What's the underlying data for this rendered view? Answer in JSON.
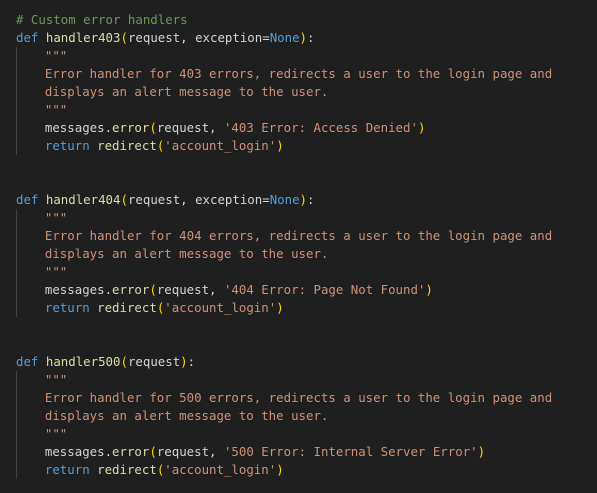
{
  "editor": {
    "comment": "# Custom error handlers",
    "blocks": [
      {
        "def_kw": "def",
        "func_name": "handler403",
        "params": "request, exception=None",
        "param_request": "request",
        "param_sep": ", ",
        "param_exception": "exception",
        "param_eq": "=",
        "param_default": "None",
        "close_colon": ":",
        "doc_open": "\"\"\"",
        "doc_line1": "Error handler for 403 errors, redirects a user to the login page and",
        "doc_line2": "displays an alert message to the user.",
        "doc_close": "\"\"\"",
        "messages_obj": "messages",
        "messages_method": "error",
        "messages_arg1": "request",
        "messages_arg2": "'403 Error: Access Denied'",
        "return_kw": "return",
        "redirect_fn": "redirect",
        "redirect_arg": "'account_login'"
      },
      {
        "def_kw": "def",
        "func_name": "handler404",
        "param_request": "request",
        "param_sep": ", ",
        "param_exception": "exception",
        "param_eq": "=",
        "param_default": "None",
        "close_colon": ":",
        "doc_open": "\"\"\"",
        "doc_line1": "Error handler for 404 errors, redirects a user to the login page and",
        "doc_line2": "displays an alert message to the user.",
        "doc_close": "\"\"\"",
        "messages_obj": "messages",
        "messages_method": "error",
        "messages_arg1": "request",
        "messages_arg2": "'404 Error: Page Not Found'",
        "return_kw": "return",
        "redirect_fn": "redirect",
        "redirect_arg": "'account_login'"
      },
      {
        "def_kw": "def",
        "func_name": "handler500",
        "param_request": "request",
        "close_colon": ":",
        "doc_open": "\"\"\"",
        "doc_line1": "Error handler for 500 errors, redirects a user to the login page and",
        "doc_line2": "displays an alert message to the user.",
        "doc_close": "\"\"\"",
        "messages_obj": "messages",
        "messages_method": "error",
        "messages_arg1": "request",
        "messages_arg2": "'500 Error: Internal Server Error'",
        "return_kw": "return",
        "redirect_fn": "redirect",
        "redirect_arg": "'account_login'"
      }
    ],
    "colors": {
      "background": "#1f1f1f",
      "comment": "#6a9955",
      "keyword": "#569cd6",
      "function": "#dcdcaa",
      "bracket": "#ffd700",
      "string": "#ce9178",
      "control_flow": "#c586c0",
      "text": "#d4d4d4"
    }
  }
}
